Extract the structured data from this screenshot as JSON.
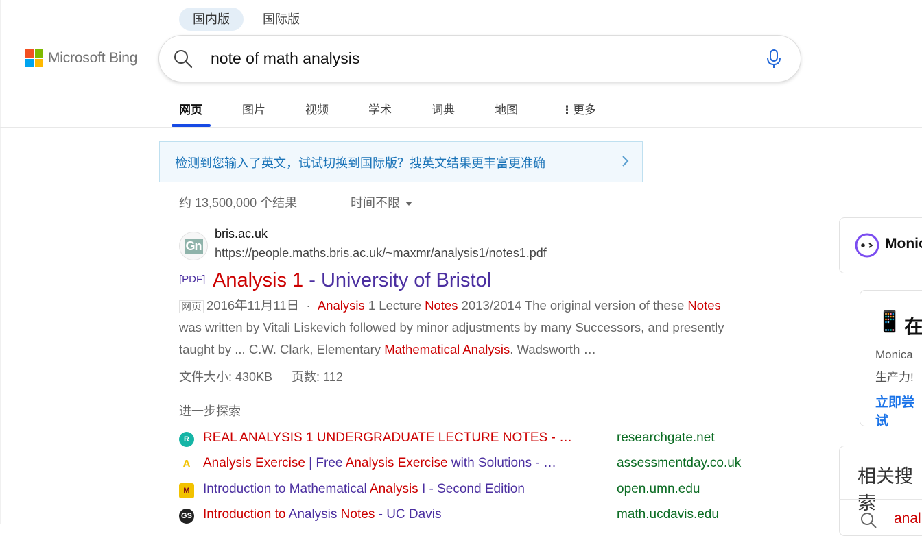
{
  "header": {
    "version_tabs": [
      "国内版",
      "国际版"
    ],
    "logo_text": "Microsoft Bing",
    "search_query": "note of math analysis",
    "nav_tabs": [
      "网页",
      "图片",
      "视频",
      "学术",
      "词典",
      "地图",
      "更多"
    ]
  },
  "banner": {
    "text": "检测到您输入了英文，试试切换到国际版？搜英文结果更丰富更准确"
  },
  "results_meta": {
    "count": "约 13,500,000 个结果",
    "time_filter": "时间不限"
  },
  "result": {
    "site": "bris.ac.uk",
    "url": "https://people.maths.bris.ac.uk/~maxmr/analysis1/notes1.pdf",
    "pdf_tag": "[PDF]",
    "title_hl": "Analysis 1",
    "title_rest": " - University of Bristol",
    "web_tag": "网页",
    "date": "2016年11月11日",
    "snippet": {
      "s1": "Analysis",
      "s2": " 1 Lecture ",
      "s3": "Notes",
      "s4": " 2013/2014 The original version of these ",
      "s5": "Notes",
      "s6": "was written by Vitali Liskevich followed by minor adjustments by many Successors, and presently",
      "s7": "taught by ... C.W. Clark, Elementary ",
      "s8": "Mathematical Analysis",
      "s9": ". Wadsworth …"
    },
    "file_size": "文件大小: 430KB",
    "pages": "页数: 112",
    "explore_heading": "进一步探索"
  },
  "related_links": [
    {
      "icon": "R",
      "title_parts": [
        {
          "t": "REAL ANALYSIS 1 UNDERGRADUATE LECTURE NOTES - …",
          "hl": true
        }
      ],
      "domain": "researchgate.net",
      "color": "#16b5a6"
    },
    {
      "icon": "A",
      "title_parts": [
        {
          "t": "Analysis Exercise",
          "hl": true
        },
        {
          "t": " | Free ",
          "hl": false
        },
        {
          "t": "Analysis Exercise",
          "hl": true
        },
        {
          "t": " with Solutions - …",
          "hl": false
        }
      ],
      "domain": "assessmentday.co.uk",
      "color": "#f2c200"
    },
    {
      "icon": "M",
      "title_parts": [
        {
          "t": "Introduction to Mathematical ",
          "hl": false
        },
        {
          "t": "Analysis",
          "hl": true
        },
        {
          "t": " I - Second Edition",
          "hl": false
        }
      ],
      "domain": "open.umn.edu",
      "color": "#7a0019"
    },
    {
      "icon": "GS",
      "title_parts": [
        {
          "t": "Introduction to ",
          "hl": true
        },
        {
          "t": "Analysis",
          "hl": false
        },
        {
          "t": " Notes",
          "hl": true
        },
        {
          "t": " - UC Davis",
          "hl": false
        }
      ],
      "domain": "math.ucdavis.edu",
      "color": "#222222"
    }
  ],
  "sidebar": {
    "monica_name": "Monic",
    "promo_head": "在",
    "promo_line1": "Monica",
    "promo_line2": "生产力!",
    "promo_link": "立即尝试",
    "related_head": "相关搜索",
    "related_item": "anal"
  },
  "colors": {
    "accent": "#174ae4",
    "link": "#4b2fa0",
    "highlight": "#c00000",
    "domain": "#0a6b22"
  }
}
